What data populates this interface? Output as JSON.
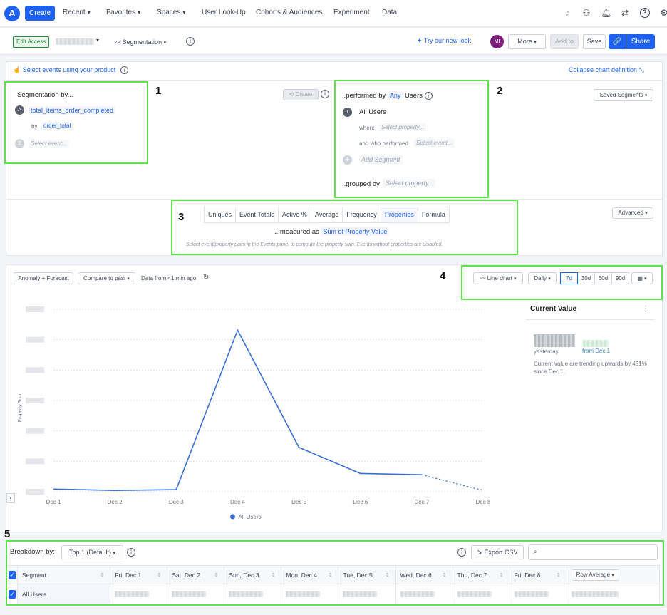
{
  "topnav": {
    "logo": "A",
    "create_label": "Create",
    "items": [
      {
        "label": "Recent",
        "chevron": true
      },
      {
        "label": "Favorites",
        "chevron": true
      },
      {
        "label": "Spaces",
        "chevron": true
      },
      {
        "label": "User Look-Up",
        "chevron": false
      },
      {
        "label": "Cohorts & Audiences",
        "chevron": false
      },
      {
        "label": "Experiment",
        "chevron": false
      },
      {
        "label": "Data",
        "chevron": false
      }
    ],
    "icons": [
      "search-icon",
      "chart-icon",
      "bell-icon",
      "swap-icon",
      "help-icon",
      "settings-icon"
    ]
  },
  "subbar": {
    "edit_access": "Edit Access",
    "chart_type": "Segmentation",
    "try_new_look": "Try our new look",
    "avatar": "MI",
    "more": "More",
    "add_to": "Add to",
    "save": "Save",
    "share": "Share"
  },
  "definition": {
    "select_events": "Select events using your product",
    "collapse": "Collapse chart definition",
    "segmentation_by": "Segmentation by...",
    "create": "Create",
    "event_a_letter": "A",
    "event_a": "total_items_order_completed",
    "by_label": "by",
    "by_property": "order_total",
    "event_b_letter": "B",
    "event_b_placeholder": "Select event...",
    "performed_by": "..performed by",
    "any": "Any",
    "users": "Users",
    "saved_segments": "Saved Segments",
    "segment_num": "1",
    "all_users": "All Users",
    "where": "where",
    "where_placeholder": "Select property...",
    "and_who_performed": "and who performed",
    "performed_placeholder": "Select event...",
    "add_segment": "Add Segment",
    "grouped_by": "..grouped by",
    "grouped_placeholder": "Select property...",
    "advanced": "Advanced",
    "measure_tabs": [
      "Uniques",
      "Event Totals",
      "Active %",
      "Average",
      "Frequency",
      "Properties",
      "Formula"
    ],
    "active_tab": "Properties",
    "measured_as": "...measured as",
    "measured_value": "Sum of Property Value",
    "note": "Select event/property pairs in the Events panel to compute the property sum. Events without properties are disabled."
  },
  "annotations": {
    "n1": "1",
    "n2": "2",
    "n3": "3",
    "n4": "4",
    "n5": "5"
  },
  "chart_controls": {
    "anomaly": "Anomaly + Forecast",
    "compare": "Compare to past",
    "data_from": "Data from <1 min ago",
    "line_chart": "Line chart",
    "daily": "Daily",
    "ranges": [
      "7d",
      "30d",
      "60d",
      "90d"
    ],
    "active_range": "7d"
  },
  "current_value": {
    "title": "Current Value",
    "yesterday": "yesterday",
    "from": "from Dec 1",
    "trend_text": "Current value are trending upwards by 481% since Dec 1."
  },
  "chart_data": {
    "type": "line",
    "x": [
      "Dec 1",
      "Dec 2",
      "Dec 3",
      "Dec 4",
      "Dec 5",
      "Dec 6",
      "Dec 7",
      "Dec 8"
    ],
    "series": [
      {
        "name": "All Users",
        "values": [
          1,
          0.5,
          0.8,
          62,
          17,
          7,
          6.5,
          0.5
        ],
        "incomplete_from_index": 6,
        "color": "#3b6fd1"
      }
    ],
    "ylabel": "Property Sum",
    "ylim": [
      0,
      70
    ],
    "grid": true,
    "legend": "bottom-center"
  },
  "breakdown": {
    "label": "Breakdown by:",
    "top_select": "Top 1 (Default)",
    "export": "Export CSV",
    "columns": [
      "Segment",
      "Fri, Dec 1",
      "Sat, Dec 2",
      "Sun, Dec 3",
      "Mon, Dec 4",
      "Tue, Dec 5",
      "Wed, Dec 6",
      "Thu, Dec 7",
      "Fri, Dec 8",
      "Row Average"
    ],
    "row_label": "All Users"
  }
}
